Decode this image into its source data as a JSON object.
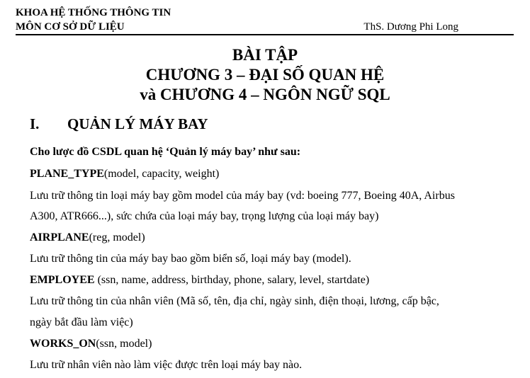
{
  "header": {
    "department": "KHOA HỆ THỐNG THÔNG TIN",
    "subject": "MÔN CƠ SỞ DỮ LIỆU",
    "author": "ThS. Dương Phi Long"
  },
  "title": {
    "line1": "BÀI TẬP",
    "line2": "CHƯƠNG 3 – ĐẠI SỐ QUAN HỆ",
    "line3": "và CHƯƠNG 4 – NGÔN NGỮ SQL"
  },
  "section": {
    "number": "I.",
    "heading": "QUẢN LÝ MÁY BAY"
  },
  "intro": "Cho lược đồ CSDL quan hệ ‘Quản lý máy bay’ như sau:",
  "relations": {
    "plane_type": {
      "name": "PLANE_TYPE",
      "attributes": "(model, capacity, weight)",
      "desc_line1": "Lưu trữ thông tin loại máy bay gồm model của máy bay (vd: boeing 777, Boeing 40A, Airbus",
      "desc_line2": "A300, ATR666...), sức chứa của loại máy bay, trọng lượng của loại máy bay)"
    },
    "airplane": {
      "name": "AIRPLANE",
      "attributes": "(reg, model)",
      "desc_line1": "Lưu trữ thông tin của máy bay bao gồm biển số, loại máy bay (model)."
    },
    "employee": {
      "name": "EMPLOYEE",
      "attributes": " (ssn, name, address, birthday, phone, salary, level, startdate)",
      "desc_line1": "Lưu trữ thông tin của nhân viên (Mã số, tên, địa chỉ, ngày sinh, điện thoại, lương, cấp bậc,",
      "desc_line2": "ngày bắt đầu làm việc)"
    },
    "works_on": {
      "name": "WORKS_ON",
      "attributes": "(ssn, model)",
      "desc_line1": "Lưu trữ nhân viên nào làm việc được trên loại máy bay nào."
    }
  }
}
